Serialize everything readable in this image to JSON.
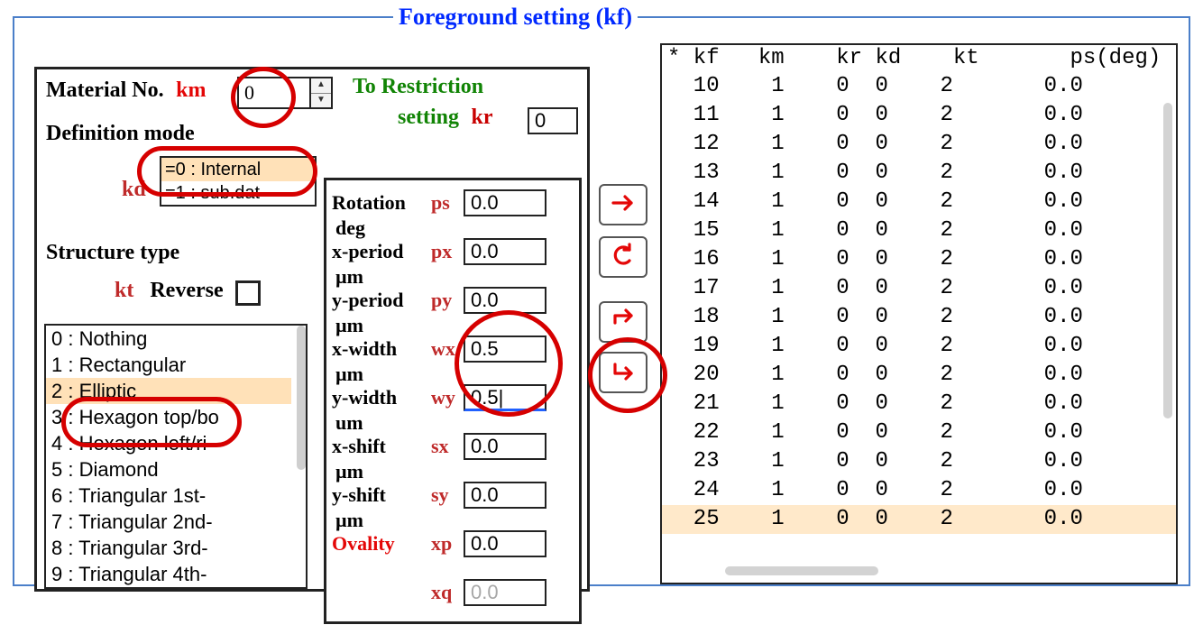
{
  "title": "Foreground setting (kf)",
  "material": {
    "label": "Material No.",
    "code": "km",
    "value": "0"
  },
  "restriction": {
    "label": "To Restriction",
    "label2": "setting",
    "code": "kr",
    "value": "0"
  },
  "definition_mode": {
    "label": "Definition mode",
    "code": "kd",
    "items": [
      "=0 : Internal",
      "=1 : sub.dat"
    ],
    "selected": 0
  },
  "structure_type": {
    "label": "Structure type",
    "code": "kt",
    "reverse_label": "Reverse",
    "reverse_checked": false,
    "items": [
      "0 : Nothing",
      "1 : Rectangular",
      "2 : Elliptic",
      "3 : Hexagon top/bo",
      "4 : Hexagon left/ri",
      "5 : Diamond",
      "6 : Triangular 1st-",
      "7 : Triangular 2nd-",
      "8 : Triangular 3rd-",
      "9 : Triangular 4th-"
    ],
    "selected": 2
  },
  "params": {
    "rows": [
      {
        "label": "Rotation",
        "code": "ps",
        "value": "0.0",
        "unit": "deg",
        "label_class": "bold"
      },
      {
        "label": "x-period",
        "code": "px",
        "value": "0.0",
        "unit": "µm",
        "label_class": "bold"
      },
      {
        "label": "y-period",
        "code": "py",
        "value": "0.0",
        "unit": "µm",
        "label_class": "bold"
      },
      {
        "label": "x-width",
        "code": "wx",
        "value": "0.5",
        "unit": "µm",
        "label_class": "bold"
      },
      {
        "label": "y-width",
        "code": "wy",
        "value": "0.5|",
        "unit": "um",
        "label_class": "bold",
        "active": true
      },
      {
        "label": "x-shift",
        "code": "sx",
        "value": "0.0",
        "unit": "µm",
        "label_class": "bold"
      },
      {
        "label": "y-shift",
        "code": "sy",
        "value": "0.0",
        "unit": "µm",
        "label_class": "bold"
      },
      {
        "label": "Ovality",
        "code": "xp",
        "value": "0.0",
        "unit": "",
        "label_class": "red"
      },
      {
        "label": "",
        "code": "xq",
        "value": "0.0",
        "unit": "",
        "label_class": "",
        "dim": true
      }
    ]
  },
  "buttons": {
    "arrow_right": "arrow-right",
    "arrow_loop": "arrow-loop",
    "arrow_skip": "arrow-skip",
    "arrow_down": "arrow-down"
  },
  "table": {
    "header": "* kf   km    kr kd    kt       ps(deg)",
    "rows": [
      {
        "kf": 10,
        "km": 1,
        "kr": 0,
        "kd": 0,
        "kt": 2,
        "ps": "0.0"
      },
      {
        "kf": 11,
        "km": 1,
        "kr": 0,
        "kd": 0,
        "kt": 2,
        "ps": "0.0"
      },
      {
        "kf": 12,
        "km": 1,
        "kr": 0,
        "kd": 0,
        "kt": 2,
        "ps": "0.0"
      },
      {
        "kf": 13,
        "km": 1,
        "kr": 0,
        "kd": 0,
        "kt": 2,
        "ps": "0.0"
      },
      {
        "kf": 14,
        "km": 1,
        "kr": 0,
        "kd": 0,
        "kt": 2,
        "ps": "0.0"
      },
      {
        "kf": 15,
        "km": 1,
        "kr": 0,
        "kd": 0,
        "kt": 2,
        "ps": "0.0"
      },
      {
        "kf": 16,
        "km": 1,
        "kr": 0,
        "kd": 0,
        "kt": 2,
        "ps": "0.0"
      },
      {
        "kf": 17,
        "km": 1,
        "kr": 0,
        "kd": 0,
        "kt": 2,
        "ps": "0.0"
      },
      {
        "kf": 18,
        "km": 1,
        "kr": 0,
        "kd": 0,
        "kt": 2,
        "ps": "0.0"
      },
      {
        "kf": 19,
        "km": 1,
        "kr": 0,
        "kd": 0,
        "kt": 2,
        "ps": "0.0"
      },
      {
        "kf": 20,
        "km": 1,
        "kr": 0,
        "kd": 0,
        "kt": 2,
        "ps": "0.0"
      },
      {
        "kf": 21,
        "km": 1,
        "kr": 0,
        "kd": 0,
        "kt": 2,
        "ps": "0.0"
      },
      {
        "kf": 22,
        "km": 1,
        "kr": 0,
        "kd": 0,
        "kt": 2,
        "ps": "0.0"
      },
      {
        "kf": 23,
        "km": 1,
        "kr": 0,
        "kd": 0,
        "kt": 2,
        "ps": "0.0"
      },
      {
        "kf": 24,
        "km": 1,
        "kr": 0,
        "kd": 0,
        "kt": 2,
        "ps": "0.0"
      },
      {
        "kf": 25,
        "km": 1,
        "kr": 0,
        "kd": 0,
        "kt": 2,
        "ps": "0.0"
      }
    ],
    "selected": 15
  }
}
